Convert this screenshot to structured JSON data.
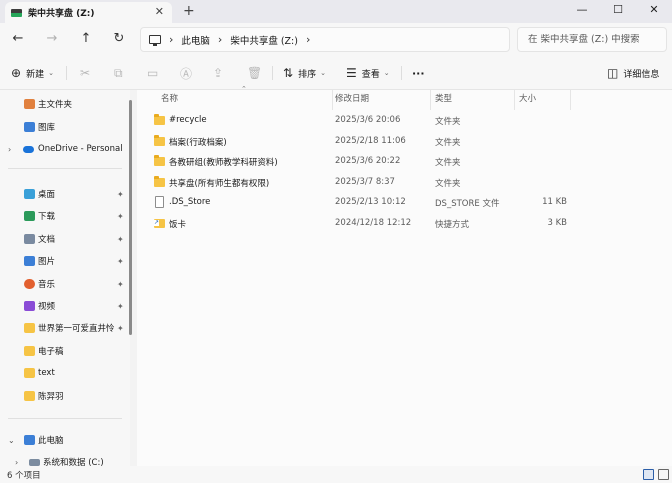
{
  "tab": {
    "title": "柴中共享盘 (Z:)",
    "close": "✕",
    "new": "+"
  },
  "window": {
    "minimize": "—",
    "maximize": "☐",
    "close": "✕"
  },
  "nav": {
    "back": "←",
    "forward": "→",
    "up": "↑",
    "refresh": "↻"
  },
  "breadcrumb": {
    "root": "此电脑",
    "current": "柴中共享盘 (Z:)",
    "sep": "›"
  },
  "search": {
    "placeholder": "在 柴中共享盘 (Z:) 中搜索"
  },
  "toolbar": {
    "new_label": "新建",
    "sort_label": "排序",
    "view_label": "查看",
    "more": "···",
    "details_label": "详细信息"
  },
  "sidebar": {
    "items": [
      {
        "label": "主文件夹",
        "icon": "home-icon",
        "color": "#e1813f"
      },
      {
        "label": "图库",
        "icon": "gallery-icon",
        "color": "#3c7fd6"
      },
      {
        "label": "OneDrive - Personal",
        "icon": "cloud-icon",
        "color": "#1a73d9"
      },
      {
        "label": "桌面",
        "icon": "desktop-icon",
        "color": "#3aa0d8"
      },
      {
        "label": "下载",
        "icon": "download-icon",
        "color": "#2b9a5a"
      },
      {
        "label": "文档",
        "icon": "document-icon",
        "color": "#7a8aa0"
      },
      {
        "label": "图片",
        "icon": "picture-icon",
        "color": "#3c7fd6"
      },
      {
        "label": "音乐",
        "icon": "music-icon",
        "color": "#e2602f"
      },
      {
        "label": "视频",
        "icon": "video-icon",
        "color": "#8a4cd6"
      },
      {
        "label": "世界第一可爱直井怜",
        "icon": "folder-icon",
        "color": "#f6c445"
      },
      {
        "label": "电子稿",
        "icon": "folder-icon",
        "color": "#f6c445"
      },
      {
        "label": "text",
        "icon": "folder-icon",
        "color": "#f6c445"
      },
      {
        "label": "陈羿羽",
        "icon": "folder-icon",
        "color": "#f6c445"
      },
      {
        "label": "此电脑",
        "icon": "pc-icon",
        "color": "#3c7fd6"
      },
      {
        "label": "系统和数据 (C:)",
        "icon": "drive-icon",
        "color": "#7c8ca0"
      }
    ],
    "pin": "📌",
    "expand": "›",
    "expanded": "⌄"
  },
  "columns": {
    "name": "名称",
    "date": "修改日期",
    "type": "类型",
    "size": "大小"
  },
  "files": [
    {
      "name": "#recycle",
      "date": "2025/3/6 20:06",
      "type": "文件夹",
      "size": "",
      "kind": "folder"
    },
    {
      "name": "档案(行政档案)",
      "date": "2025/2/18 11:06",
      "type": "文件夹",
      "size": "",
      "kind": "folder"
    },
    {
      "name": "各教研组(教师教学科研资料)",
      "date": "2025/3/6 20:22",
      "type": "文件夹",
      "size": "",
      "kind": "folder"
    },
    {
      "name": "共享盘(所有师生都有权限)",
      "date": "2025/3/7 8:37",
      "type": "文件夹",
      "size": "",
      "kind": "folder"
    },
    {
      "name": ".DS_Store",
      "date": "2025/2/13 10:12",
      "type": "DS_STORE 文件",
      "size": "11 KB",
      "kind": "file"
    },
    {
      "name": "饭卡",
      "date": "2024/12/18 12:12",
      "type": "快捷方式",
      "size": "3 KB",
      "kind": "shortcut"
    }
  ],
  "status": {
    "count_text": "6 个项目"
  }
}
